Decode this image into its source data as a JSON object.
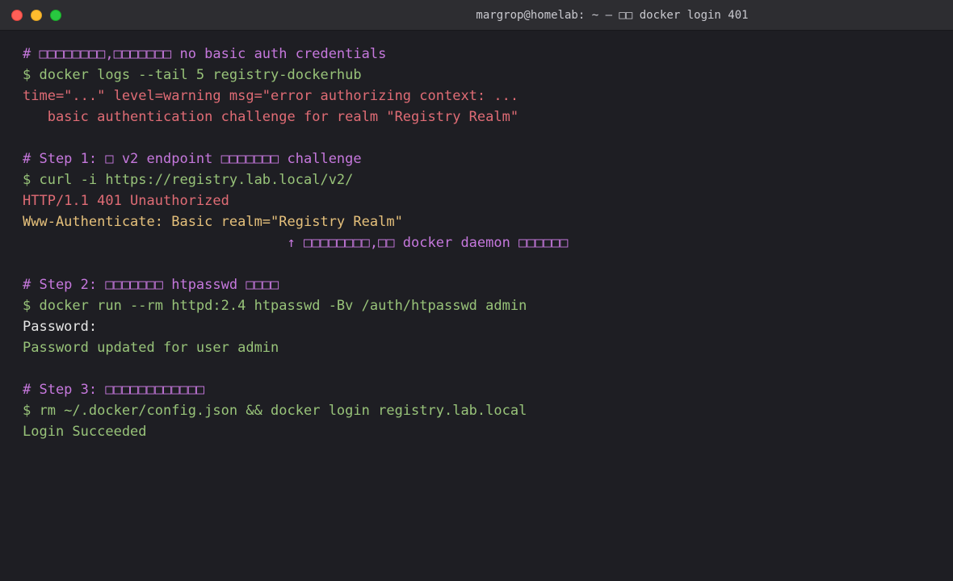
{
  "window": {
    "title": "margrop@homelab: ~ — □□ docker login 401"
  },
  "terminal": {
    "lines": [
      "# □□□□□□□□,□□□□□□□ no basic auth credentials",
      "$ docker logs --tail 5 registry-dockerhub",
      "time=\"...\" level=warning msg=\"error authorizing context: ...",
      "   basic authentication challenge for realm \"Registry Realm\"",
      "",
      "# Step 1: □ v2 endpoint □□□□□□□ challenge",
      "$ curl -i https://registry.lab.local/v2/",
      "HTTP/1.1 401 Unauthorized",
      "Www-Authenticate: Basic realm=\"Registry Realm\"",
      "                                ↑ □□□□□□□□,□□ docker daemon □□□□□□",
      "",
      "# Step 2: □□□□□□□ htpasswd □□□□",
      "$ docker run --rm httpd:2.4 htpasswd -Bv /auth/htpasswd admin",
      "Password:",
      "Password updated for user admin",
      "",
      "# Step 3: □□□□□□□□□□□□",
      "$ rm ~/.docker/config.json && docker login registry.lab.local",
      "Login Succeeded"
    ]
  }
}
